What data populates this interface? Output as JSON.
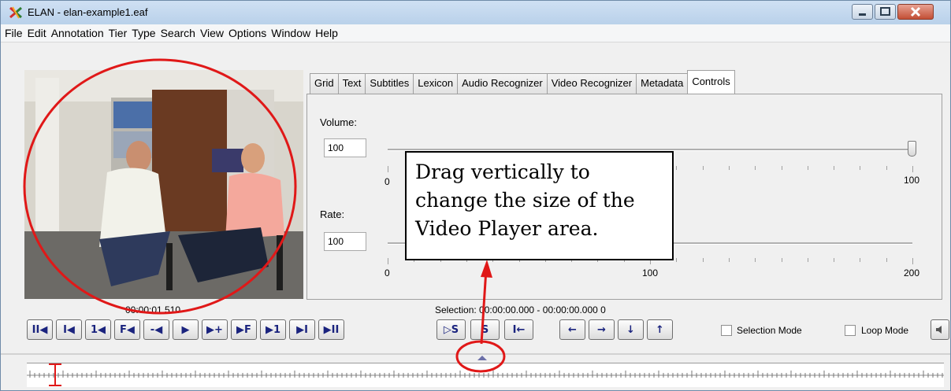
{
  "window": {
    "title": "ELAN - elan-example1.eaf"
  },
  "menu": [
    "File",
    "Edit",
    "Annotation",
    "Tier",
    "Type",
    "Search",
    "View",
    "Options",
    "Window",
    "Help"
  ],
  "video": {
    "time": "00:00:01.510"
  },
  "tabs": [
    "Grid",
    "Text",
    "Subtitles",
    "Lexicon",
    "Audio Recognizer",
    "Video Recognizer",
    "Metadata",
    "Controls"
  ],
  "active_tab": "Controls",
  "controls": {
    "volume_label": "Volume:",
    "volume_value": "100",
    "volume_min_label": "0",
    "volume_max_label": "100",
    "volume_level": 100,
    "rate_label": "Rate:",
    "rate_value": "100",
    "rate_min_label": "0",
    "rate_mid_label": "100",
    "rate_max_label": "200",
    "rate_level": 100
  },
  "callout": {
    "lines": [
      "Drag vertically to",
      "change the size of the",
      "Video Player area."
    ]
  },
  "selection": {
    "text": "Selection: 00:00:00.000 - 00:00:00.000  0"
  },
  "player_buttons": [
    "II◀",
    "I◀",
    "1◀",
    "F◀",
    "-◀",
    "▶",
    "▶+",
    "▶F",
    "▶1",
    "▶I",
    "▶II"
  ],
  "selection_buttons": [
    "▷S",
    "S",
    "I←"
  ],
  "arrow_buttons": [
    "←",
    "→",
    "↓",
    "↑"
  ],
  "options": {
    "selection_mode": "Selection Mode",
    "loop_mode": "Loop Mode"
  },
  "colors": {
    "annotation_red": "#e01818",
    "button_glyph": "#1a237e",
    "title_bar": "#b9d1ea"
  }
}
